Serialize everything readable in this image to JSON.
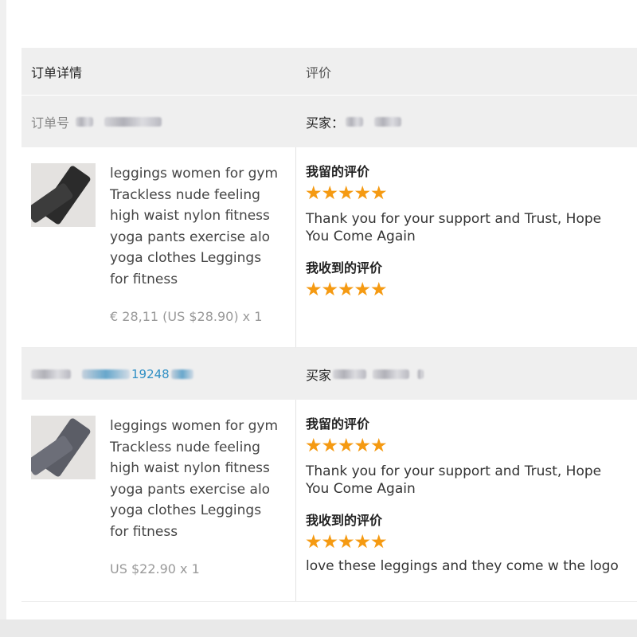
{
  "header": {
    "order_details": "订单详情",
    "review": "评价"
  },
  "orders": [
    {
      "order_label": "订单号",
      "order_number": "",
      "buyer_label": "买家：",
      "product_title": "leggings women for gym Trackless nude feeling high waist nylon fitness yoga pants exercise alo yoga clothes Leggings for fitness",
      "price": "€ 28,11 (US $28.90) x 1",
      "my_review_label": "我留的评价",
      "my_review_stars": 5,
      "my_review_text": "Thank you for your support and Trust, Hope You Come Again",
      "received_review_label": "我收到的评价",
      "received_review_stars": 5,
      "received_review_text": ""
    },
    {
      "order_label": "",
      "order_number": "19248",
      "buyer_label": "买家",
      "product_title": "leggings women for gym Trackless nude feeling high waist nylon fitness yoga pants exercise alo yoga clothes Leggings for fitness",
      "price": "US $22.90 x 1",
      "my_review_label": "我留的评价",
      "my_review_stars": 5,
      "my_review_text": "Thank you for your support and Trust, Hope You Come Again",
      "received_review_label": "我收到的评价",
      "received_review_stars": 5,
      "received_review_text": "love these leggings and they come w the logo"
    }
  ],
  "colors": {
    "star": "#f59a12",
    "link": "#2f8fc4",
    "header_bg": "#efefef"
  },
  "icons": {
    "star": "star-icon",
    "product_image": "leggings-thumbnail"
  }
}
